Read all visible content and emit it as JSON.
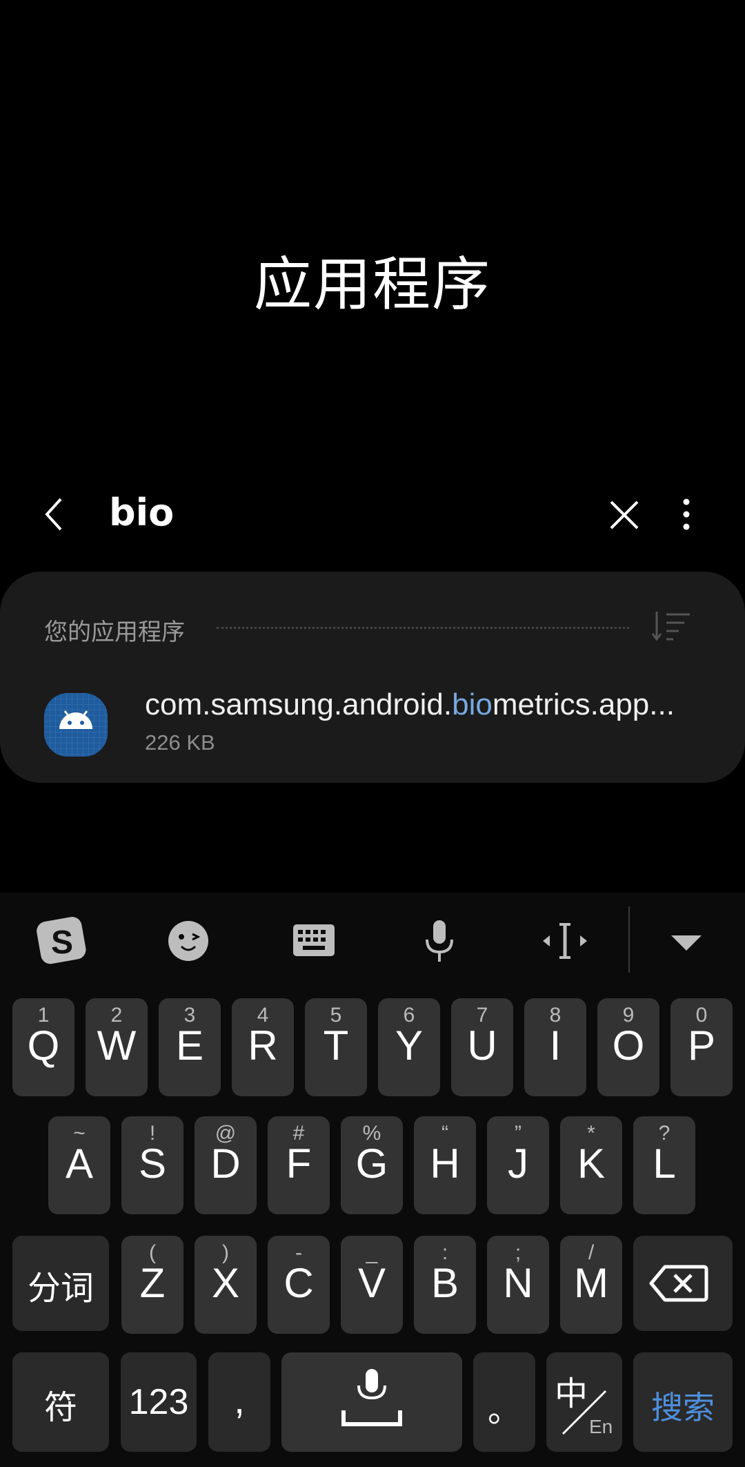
{
  "page": {
    "title": "应用程序"
  },
  "search": {
    "query": "bio"
  },
  "results": {
    "section_label": "您的应用程序",
    "apps": [
      {
        "name_prefix": "com.samsung.android.",
        "name_highlight": "bio",
        "name_suffix": "metrics.app...",
        "size": "226 KB"
      }
    ]
  },
  "keyboard": {
    "toolbar": [
      "sogou-logo-icon",
      "emoji-icon",
      "keyboard-icon",
      "microphone-icon",
      "cursor-move-icon",
      "collapse-keyboard-icon"
    ],
    "row1": [
      {
        "main": "Q",
        "sub": "1"
      },
      {
        "main": "W",
        "sub": "2"
      },
      {
        "main": "E",
        "sub": "3"
      },
      {
        "main": "R",
        "sub": "4"
      },
      {
        "main": "T",
        "sub": "5"
      },
      {
        "main": "Y",
        "sub": "6"
      },
      {
        "main": "U",
        "sub": "7"
      },
      {
        "main": "I",
        "sub": "8"
      },
      {
        "main": "O",
        "sub": "9"
      },
      {
        "main": "P",
        "sub": "0"
      }
    ],
    "row2": [
      {
        "main": "A",
        "sub": "~"
      },
      {
        "main": "S",
        "sub": "!"
      },
      {
        "main": "D",
        "sub": "@"
      },
      {
        "main": "F",
        "sub": "#"
      },
      {
        "main": "G",
        "sub": "%"
      },
      {
        "main": "H",
        "sub": "“"
      },
      {
        "main": "J",
        "sub": "”"
      },
      {
        "main": "K",
        "sub": "*"
      },
      {
        "main": "L",
        "sub": "?"
      }
    ],
    "row3": [
      {
        "main": "Z",
        "sub": "("
      },
      {
        "main": "X",
        "sub": ")"
      },
      {
        "main": "C",
        "sub": "-"
      },
      {
        "main": "V",
        "sub": "_"
      },
      {
        "main": "B",
        "sub": ":"
      },
      {
        "main": "N",
        "sub": ";"
      },
      {
        "main": "M",
        "sub": "/"
      }
    ],
    "segment_label": "分词",
    "symbols_label": "符",
    "numbers_label": "123",
    "comma_label": ",",
    "period_label": "。",
    "lang_main": "中",
    "lang_sub": "En",
    "search_label": "搜索",
    "accent_color": "#4e8fde"
  }
}
